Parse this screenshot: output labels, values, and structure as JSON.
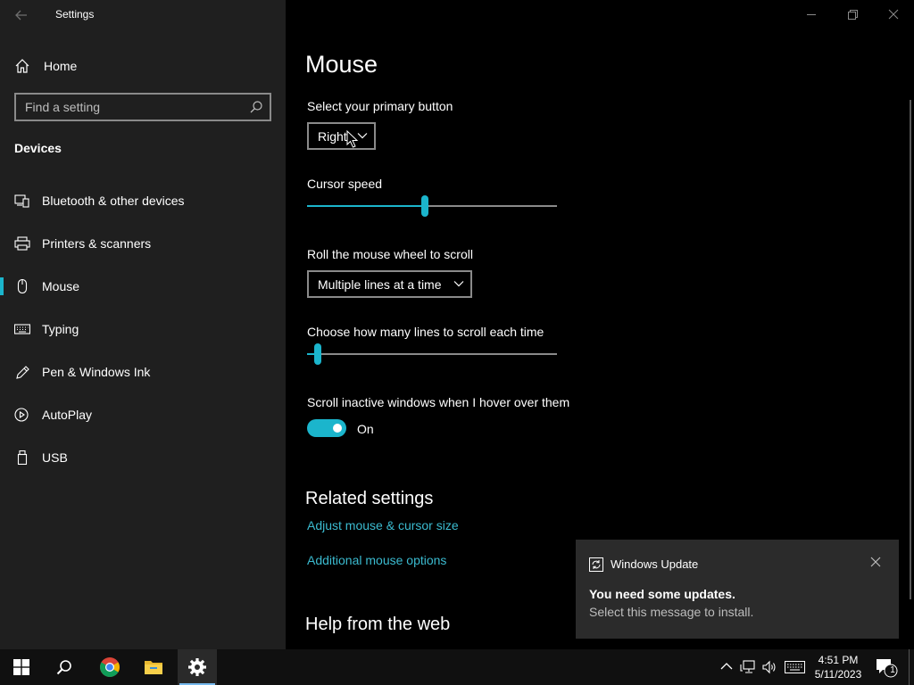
{
  "window": {
    "title": "Settings"
  },
  "sidebar": {
    "home_label": "Home",
    "search_placeholder": "Find a setting",
    "section_heading": "Devices",
    "items": [
      {
        "label": "Bluetooth & other devices",
        "icon": "bluetooth-devices-icon"
      },
      {
        "label": "Printers & scanners",
        "icon": "printer-icon"
      },
      {
        "label": "Mouse",
        "icon": "mouse-icon",
        "selected": true
      },
      {
        "label": "Typing",
        "icon": "keyboard-icon"
      },
      {
        "label": "Pen & Windows Ink",
        "icon": "pen-icon"
      },
      {
        "label": "AutoPlay",
        "icon": "autoplay-icon"
      },
      {
        "label": "USB",
        "icon": "usb-icon"
      }
    ]
  },
  "main": {
    "title": "Mouse",
    "primary_button": {
      "label": "Select your primary button",
      "value": "Right"
    },
    "cursor_speed": {
      "label": "Cursor speed",
      "level": 0.47
    },
    "scroll_mode": {
      "label": "Roll the mouse wheel to scroll",
      "value": "Multiple lines at a time"
    },
    "scroll_lines": {
      "label": "Choose how many lines to scroll each time",
      "level": 0.03
    },
    "inactive_scroll": {
      "label": "Scroll inactive windows when I hover over them",
      "state": "On"
    },
    "related": {
      "heading": "Related settings",
      "links": [
        "Adjust mouse & cursor size",
        "Additional mouse options"
      ]
    },
    "help_heading": "Help from the web"
  },
  "toast": {
    "app": "Windows Update",
    "title": "You need some updates.",
    "body": "Select this message to install."
  },
  "taskbar": {
    "apps": [
      "start-icon",
      "search-icon",
      "chrome-icon",
      "file-explorer-icon",
      "settings-icon"
    ],
    "time": "4:51 PM",
    "date": "5/11/2023",
    "notification_count": "1"
  },
  "colors": {
    "accent": "#1bb5cc",
    "link": "#3bbbd0",
    "sidebar_bg": "#1f1f1f",
    "toast_bg": "#2b2b2b"
  }
}
